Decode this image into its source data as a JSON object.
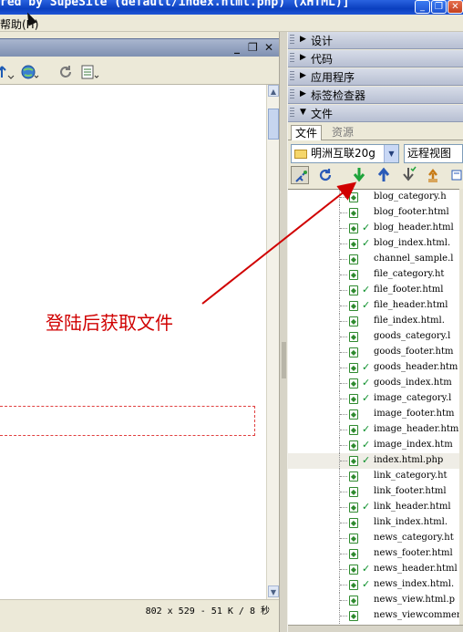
{
  "window": {
    "title": "red by SupeSite (default/index.html.php) (XHTML)]",
    "minimize_glyph": "_",
    "restore_glyph": "❐",
    "close_glyph": "✕"
  },
  "menubar": {
    "help_label": "帮助(H)"
  },
  "document": {
    "controls": {
      "minimize": "_",
      "restore": "❐",
      "close": "✕"
    },
    "status_text": "802 x 529 - 51 K / 8 秒"
  },
  "annotation": {
    "text": "登陆后获取文件",
    "color": "#d00000"
  },
  "panels": {
    "design": "设计",
    "code": "代码",
    "application": "应用程序",
    "tag_inspector": "标签检查器",
    "files": "文件"
  },
  "files_panel": {
    "tab_files": "文件",
    "tab_assets": "资源",
    "site_name": "明洲互联20g",
    "view_mode": "远程视图",
    "files": [
      {
        "name": "blog_category.h",
        "checked": false
      },
      {
        "name": "blog_footer.html",
        "checked": false
      },
      {
        "name": "blog_header.html",
        "checked": true
      },
      {
        "name": "blog_index.html.",
        "checked": true
      },
      {
        "name": "channel_sample.l",
        "checked": false
      },
      {
        "name": "file_category.ht",
        "checked": false
      },
      {
        "name": "file_footer.html",
        "checked": true
      },
      {
        "name": "file_header.html",
        "checked": true
      },
      {
        "name": "file_index.html.",
        "checked": false
      },
      {
        "name": "goods_category.l",
        "checked": false
      },
      {
        "name": "goods_footer.htm",
        "checked": false
      },
      {
        "name": "goods_header.htm",
        "checked": true
      },
      {
        "name": "goods_index.htm",
        "checked": true
      },
      {
        "name": "image_category.l",
        "checked": true
      },
      {
        "name": "image_footer.htm",
        "checked": false
      },
      {
        "name": "image_header.htm",
        "checked": true
      },
      {
        "name": "image_index.htm",
        "checked": true
      },
      {
        "name": "index.html.php",
        "checked": true
      },
      {
        "name": "link_category.ht",
        "checked": false
      },
      {
        "name": "link_footer.html",
        "checked": false
      },
      {
        "name": "link_header.html",
        "checked": true
      },
      {
        "name": "link_index.html.",
        "checked": false
      },
      {
        "name": "news_category.ht",
        "checked": false
      },
      {
        "name": "news_footer.html",
        "checked": false
      },
      {
        "name": "news_header.html",
        "checked": true
      },
      {
        "name": "news_index.html.",
        "checked": true
      },
      {
        "name": "news_view.html.p",
        "checked": false
      },
      {
        "name": "news_viewcomment",
        "checked": false
      }
    ]
  },
  "icons": {
    "connect": "connect-icon",
    "refresh": "refresh-icon",
    "get": "get-file-icon",
    "put": "put-file-icon",
    "checkout": "check-out-icon",
    "checkin": "check-in-icon",
    "expand": "expand-icon"
  }
}
